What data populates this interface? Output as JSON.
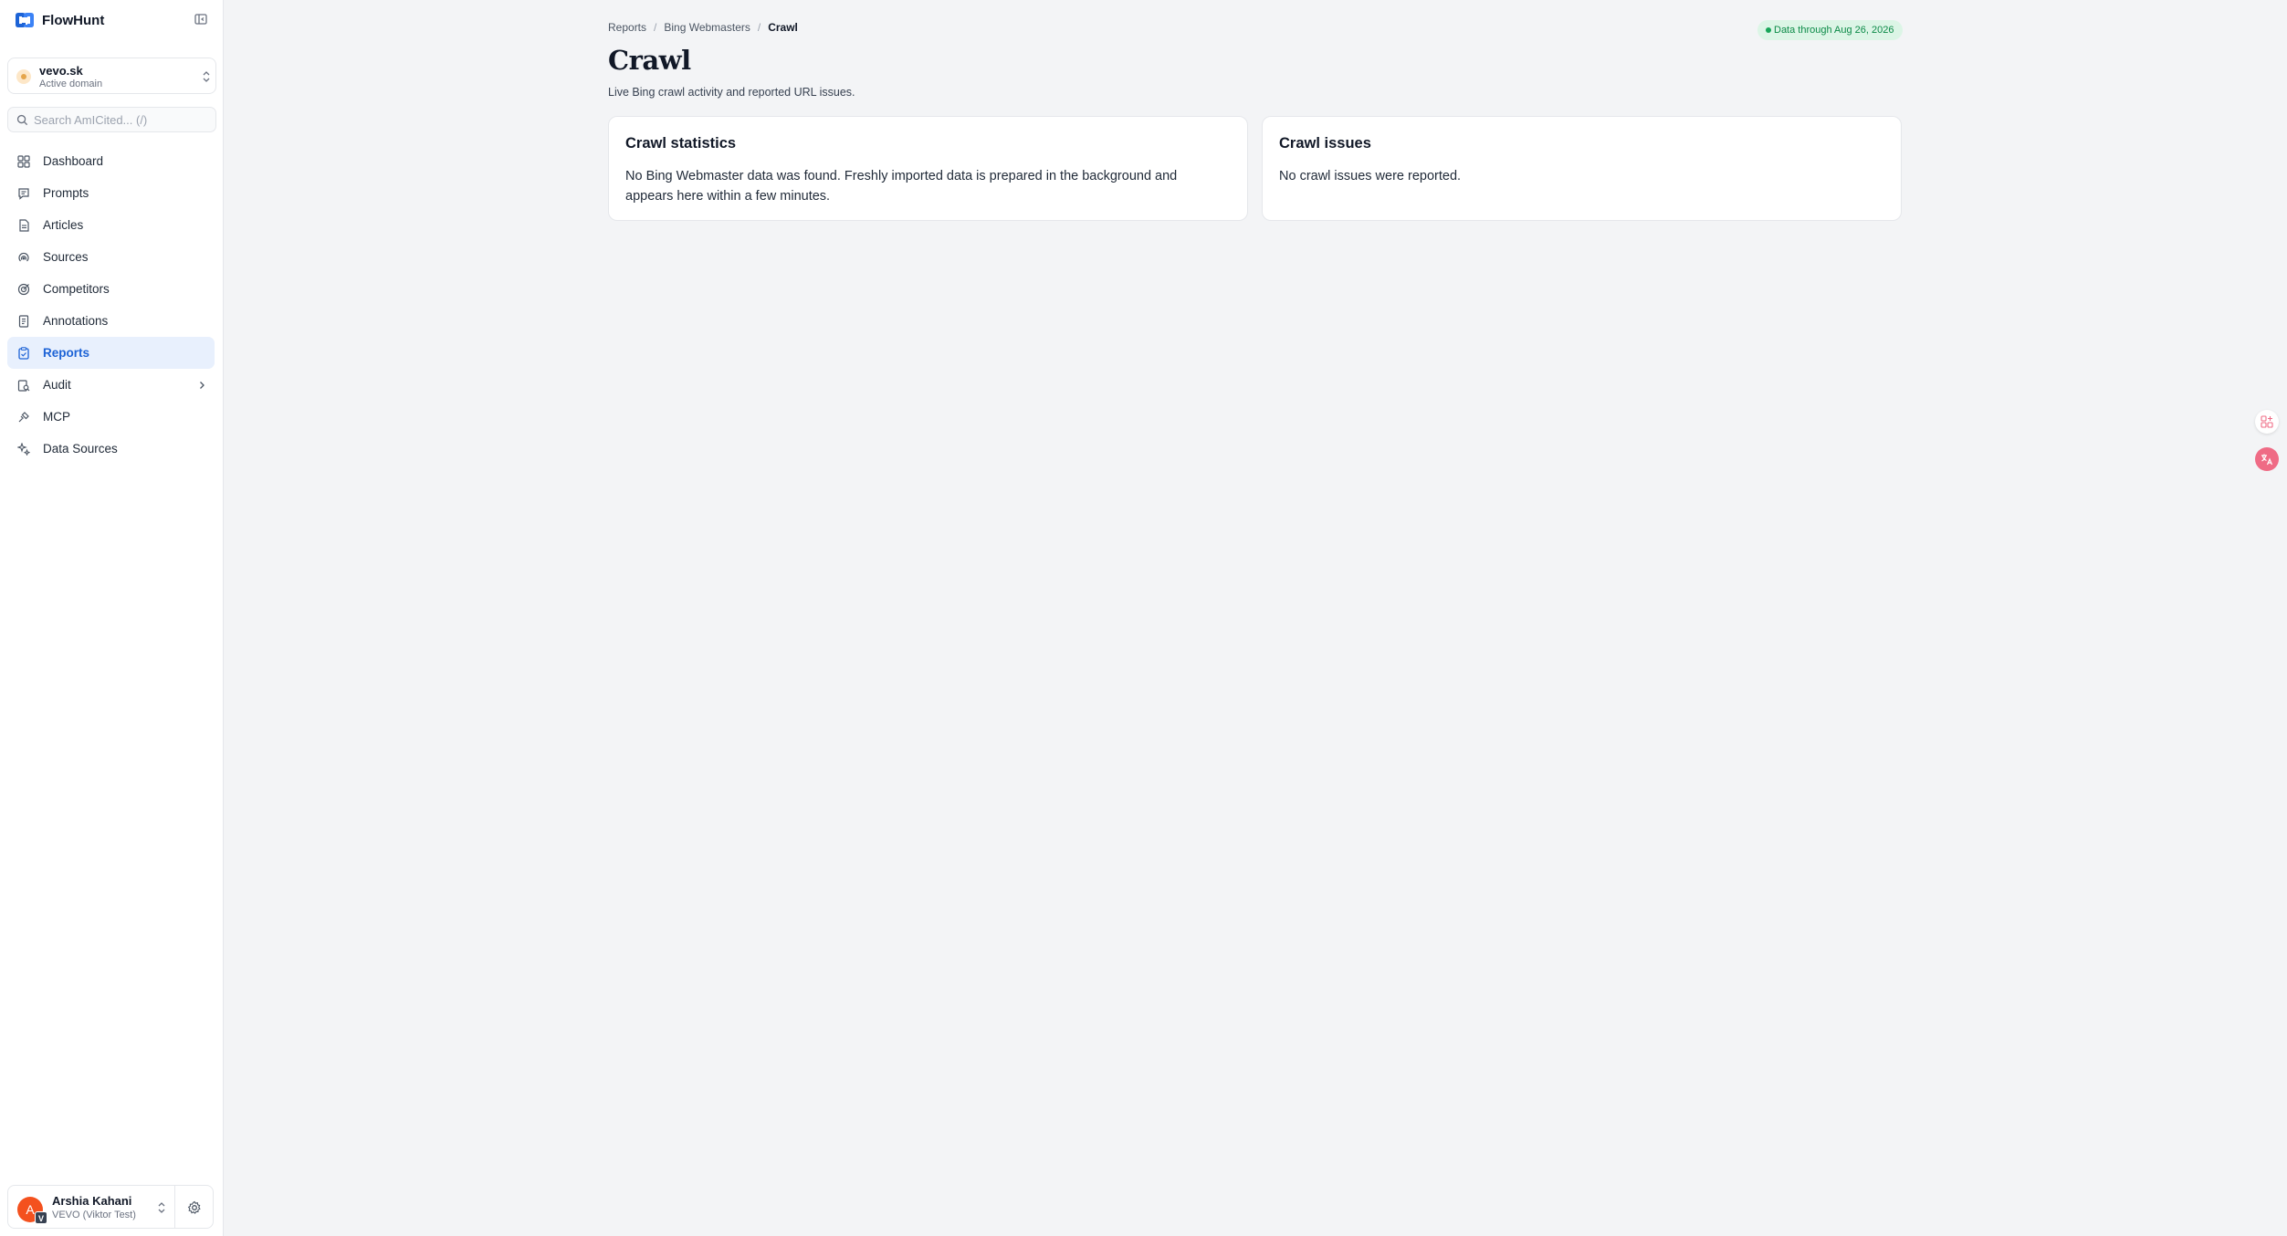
{
  "app": {
    "name": "FlowHunt"
  },
  "domain": {
    "name": "vevo.sk",
    "status": "Active domain"
  },
  "search": {
    "placeholder": "Search AmICited... (/)",
    "value": ""
  },
  "nav": {
    "items": [
      {
        "label": "Dashboard",
        "icon": "dashboard-icon",
        "active": false
      },
      {
        "label": "Prompts",
        "icon": "prompts-icon",
        "active": false
      },
      {
        "label": "Articles",
        "icon": "articles-icon",
        "active": false
      },
      {
        "label": "Sources",
        "icon": "sources-icon",
        "active": false
      },
      {
        "label": "Competitors",
        "icon": "competitors-icon",
        "active": false
      },
      {
        "label": "Annotations",
        "icon": "annotations-icon",
        "active": false
      },
      {
        "label": "Reports",
        "icon": "reports-icon",
        "active": true
      },
      {
        "label": "Audit",
        "icon": "audit-icon",
        "active": false,
        "has_submenu": true
      },
      {
        "label": "MCP",
        "icon": "mcp-icon",
        "active": false
      },
      {
        "label": "Data Sources",
        "icon": "data-sources-icon",
        "active": false
      }
    ]
  },
  "user": {
    "name": "Arshia Kahani",
    "org": "VEVO (Viktor Test)",
    "avatar_letter": "A",
    "org_badge": "V"
  },
  "breadcrumb": {
    "items": [
      "Reports",
      "Bing Webmasters"
    ],
    "current": "Crawl"
  },
  "status_badge": {
    "text": "Data through Aug 26, 2026"
  },
  "page": {
    "title": "Crawl",
    "subtitle": "Live Bing crawl activity and reported URL issues."
  },
  "cards": {
    "statistics": {
      "title": "Crawl statistics",
      "body": "No Bing Webmaster data was found. Freshly imported data is prepared in the background and appears here within a few minutes."
    },
    "issues": {
      "title": "Crawl issues",
      "body": "No crawl issues were reported."
    }
  },
  "colors": {
    "accent": "#1d63d6",
    "active_nav_bg": "#e8f0fd",
    "status_green": "#0b8a47",
    "status_bg": "#dcf5e6",
    "avatar": "#f4511e"
  }
}
